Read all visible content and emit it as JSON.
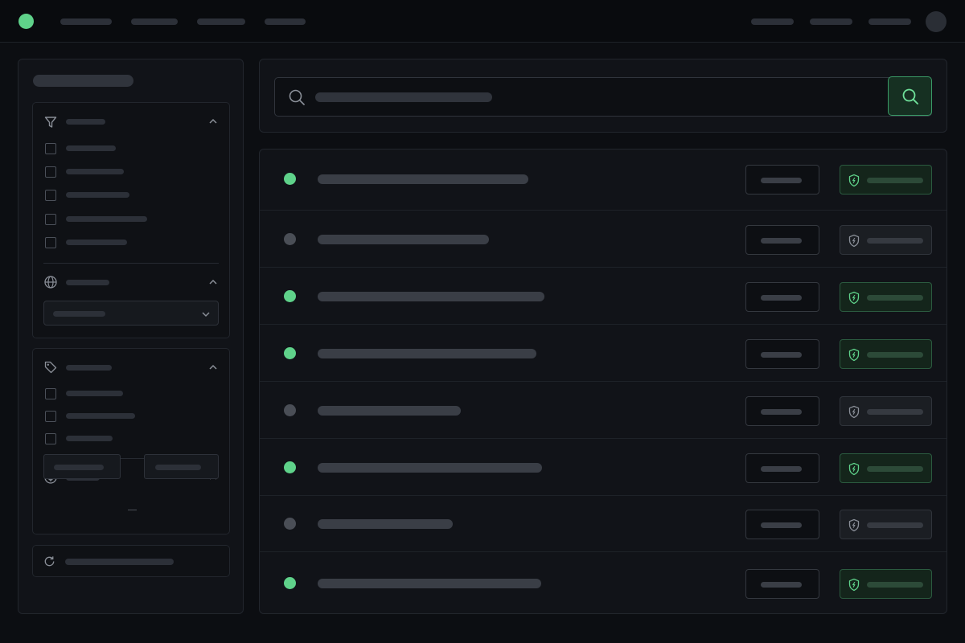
{
  "colors": {
    "accent": "#5fd28a",
    "inactive_dot": "#4a4e56",
    "panel_bg": "#111318",
    "page_bg": "#0c0e12"
  },
  "header": {
    "logo_icon": "logo-dot-icon",
    "nav_items": [
      "",
      "",
      "",
      ""
    ],
    "actions": [
      "",
      "",
      ""
    ],
    "avatar": ""
  },
  "sidebar": {
    "title": "",
    "filter_group": {
      "icon": "filter-icon",
      "label": "",
      "options": [
        "",
        "",
        "",
        "",
        ""
      ]
    },
    "region_group": {
      "icon": "globe-icon",
      "label": "",
      "selected": ""
    },
    "tag_group": {
      "icon": "tag-icon",
      "label": "",
      "options": [
        "",
        "",
        ""
      ]
    },
    "price_group": {
      "icon": "dollar-icon",
      "label": "",
      "min": "",
      "max": ""
    },
    "reset": {
      "icon": "refresh-icon",
      "label": ""
    }
  },
  "search": {
    "icon": "search-icon",
    "placeholder": "",
    "button_icon": "search-icon"
  },
  "results": {
    "rows": [
      {
        "status": "active",
        "title": "",
        "action": "",
        "badge": ""
      },
      {
        "status": "inactive",
        "title": "",
        "action": "",
        "badge": ""
      },
      {
        "status": "active",
        "title": "",
        "action": "",
        "badge": ""
      },
      {
        "status": "active",
        "title": "",
        "action": "",
        "badge": ""
      },
      {
        "status": "inactive",
        "title": "",
        "action": "",
        "badge": ""
      },
      {
        "status": "active",
        "title": "",
        "action": "",
        "badge": ""
      },
      {
        "status": "inactive",
        "title": "",
        "action": "",
        "badge": ""
      },
      {
        "status": "active",
        "title": "",
        "action": "",
        "badge": ""
      }
    ]
  }
}
